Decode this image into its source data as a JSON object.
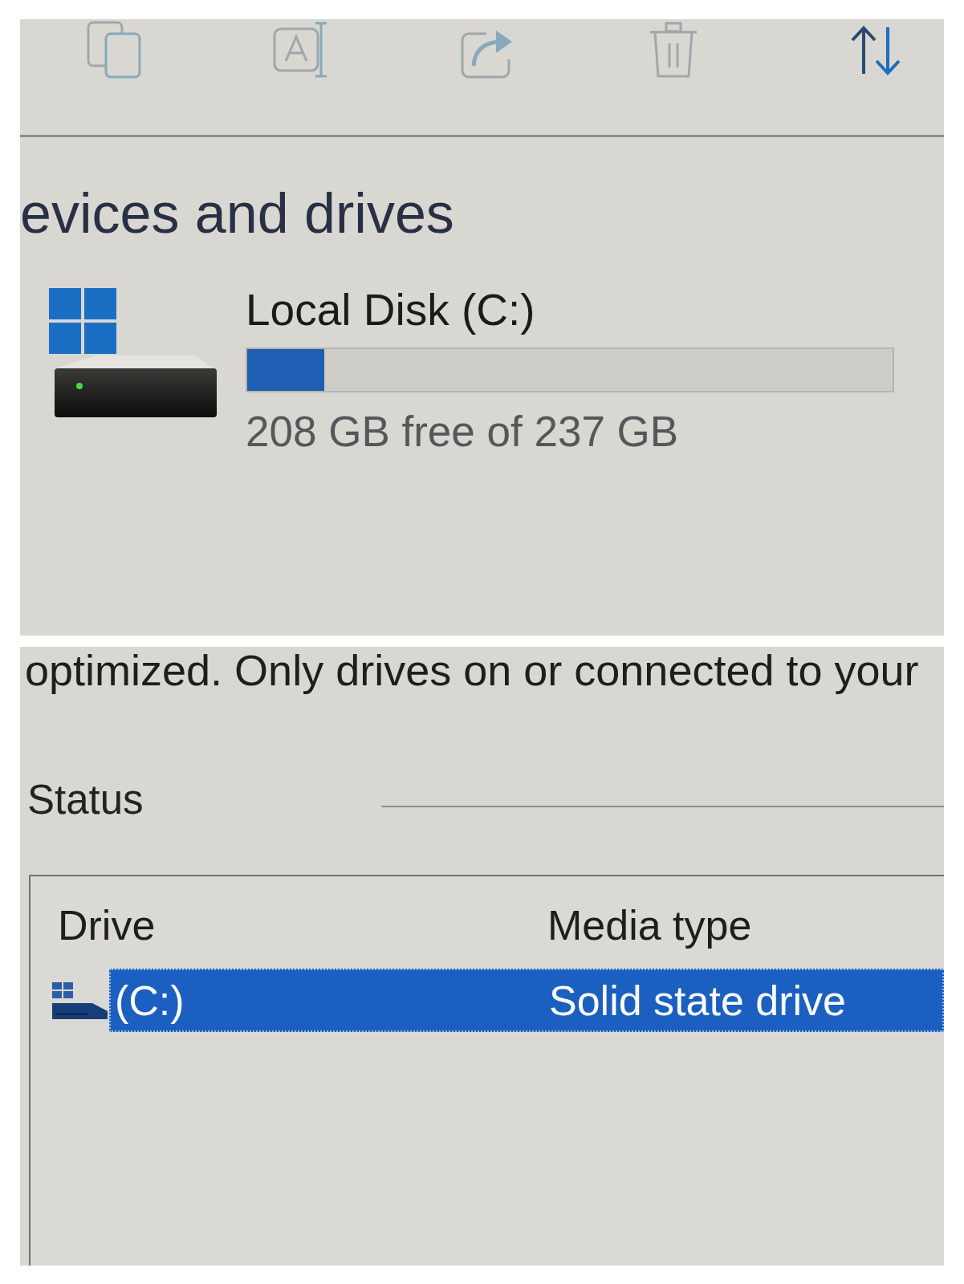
{
  "toolbar": {
    "buttons": [
      {
        "kind": "copy",
        "disabled": true
      },
      {
        "kind": "rename",
        "disabled": true
      },
      {
        "kind": "share",
        "disabled": true
      },
      {
        "kind": "delete",
        "disabled": true
      },
      {
        "kind": "sort",
        "disabled": false
      }
    ]
  },
  "devices_section": {
    "heading": "evices and drives",
    "drives": [
      {
        "name": "Local Disk (C:)",
        "level": 0.12,
        "reading": "208 GB free of 237 GB"
      }
    ]
  },
  "optimize_panel": {
    "description": "optimized. Only drives on or connected to your",
    "status_label": "Status",
    "drive_list": {
      "columns": [
        "Drive",
        "Media type"
      ],
      "rows": [
        {
          "drive": "(C:)",
          "media_type": "Solid state drive",
          "selected": true
        }
      ]
    }
  }
}
